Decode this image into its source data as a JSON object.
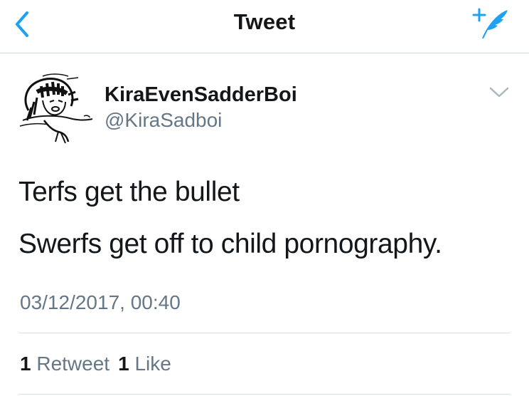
{
  "navbar": {
    "title": "Tweet",
    "back_icon": "chevron-left-icon",
    "compose_icon": "compose-tweet-icon",
    "accent_color": "#1da1f2"
  },
  "tweet": {
    "author": {
      "display_name": "KiraEvenSadderBoi",
      "handle": "@KiraSadboi",
      "avatar_icon": "avatar-drawing"
    },
    "menu_icon": "chevron-down-icon",
    "lines": [
      "Terfs get the bullet",
      "Swerfs get off to child pornography."
    ],
    "timestamp": "03/12/2017, 00:40",
    "stats": {
      "retweets_count": "1",
      "retweets_label": "Retweet",
      "likes_count": "1",
      "likes_label": "Like"
    }
  }
}
